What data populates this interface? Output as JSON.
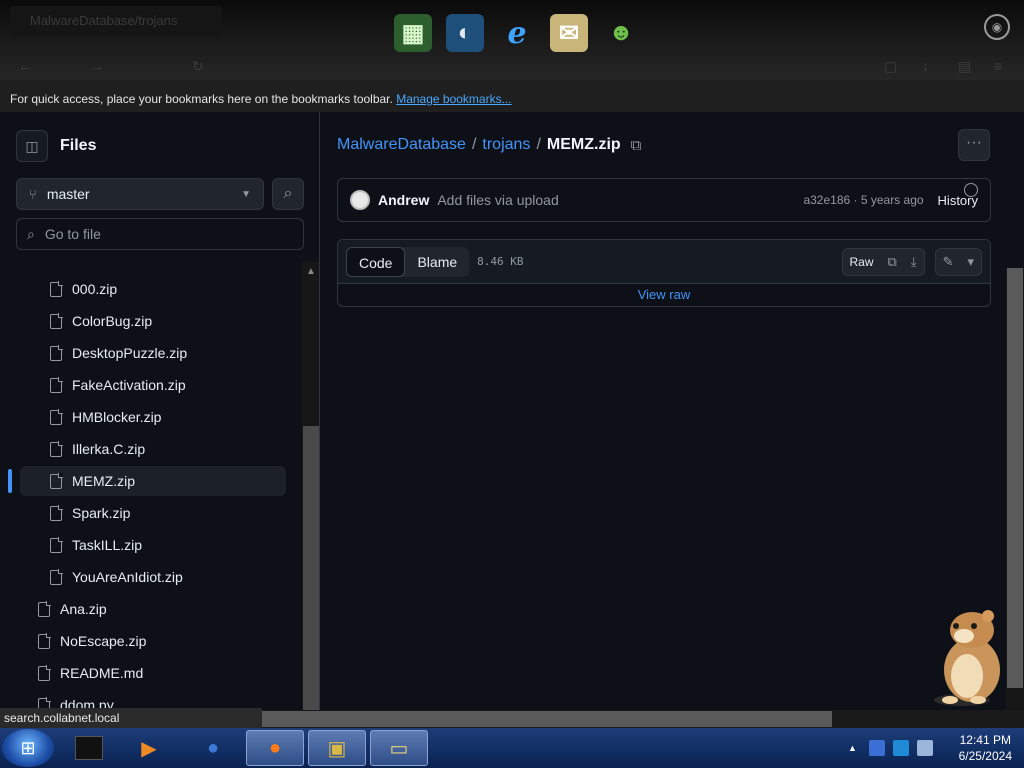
{
  "browser": {
    "ghost_tab_title": "MalwareDatabase/trojans",
    "bookmarks_text": "For quick access, place your bookmarks here on the bookmarks toolbar.",
    "bookmarks_link": "Manage bookmarks...",
    "status_url": "search.collabnet.local"
  },
  "sidebar": {
    "title": "Files",
    "branch": "master",
    "goto_placeholder": "Go to file",
    "items": [
      {
        "name": "000.zip",
        "indent": 1
      },
      {
        "name": "ColorBug.zip",
        "indent": 1
      },
      {
        "name": "DesktopPuzzle.zip",
        "indent": 1
      },
      {
        "name": "FakeActivation.zip",
        "indent": 1
      },
      {
        "name": "HMBlocker.zip",
        "indent": 1
      },
      {
        "name": "Illerka.C.zip",
        "indent": 1
      },
      {
        "name": "MEMZ.zip",
        "indent": 1,
        "selected": true
      },
      {
        "name": "Spark.zip",
        "indent": 1
      },
      {
        "name": "TaskILL.zip",
        "indent": 1
      },
      {
        "name": "YouAreAnIdiot.zip",
        "indent": 1
      },
      {
        "name": "Ana.zip",
        "indent": 0
      },
      {
        "name": "NoEscape.zip",
        "indent": 0
      },
      {
        "name": "README.md",
        "indent": 0
      },
      {
        "name": "ddom.py",
        "indent": 0
      }
    ]
  },
  "breadcrumb": {
    "repo": "MalwareDatabase",
    "folder": "trojans",
    "file": "MEMZ.zip",
    "separator": "/"
  },
  "commit": {
    "author": "Andrew",
    "message": "Add files via upload",
    "meta": "a32e186 · 5 years ago",
    "history_label": "History"
  },
  "file": {
    "tab_code": "Code",
    "tab_blame": "Blame",
    "size": "8.46 KB",
    "raw_label": "Raw",
    "view_raw": "View raw"
  },
  "taskbar": {
    "time": "12:41 PM",
    "date": "6/25/2024"
  },
  "colors": {
    "accent": "#4493f8",
    "background": "#0d1117",
    "border": "#30363d"
  }
}
